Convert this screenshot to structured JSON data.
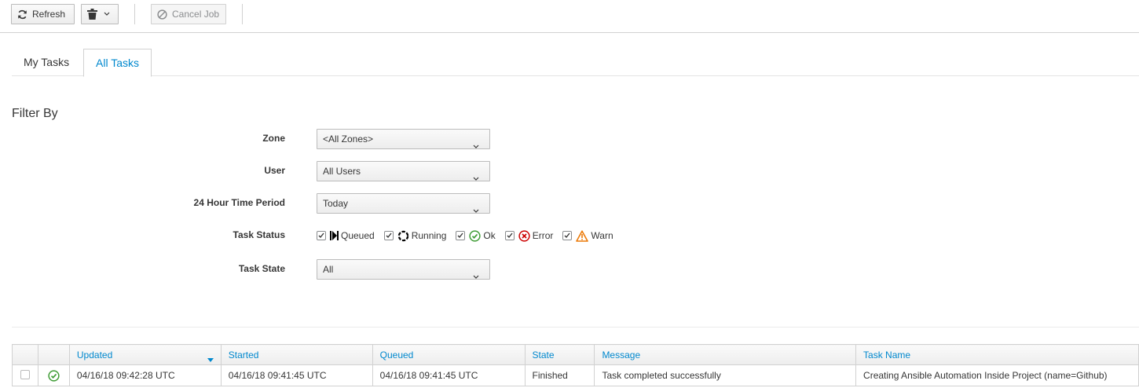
{
  "toolbar": {
    "refresh_label": "Refresh",
    "cancel_job_label": "Cancel Job"
  },
  "tabs": [
    {
      "label": "My Tasks",
      "active": false
    },
    {
      "label": "All Tasks",
      "active": true
    }
  ],
  "filter": {
    "title": "Filter By",
    "zone": {
      "label": "Zone",
      "value": "<All Zones>"
    },
    "user": {
      "label": "User",
      "value": "All Users"
    },
    "period": {
      "label": "24 Hour Time Period",
      "value": "Today"
    },
    "task_status": {
      "label": "Task Status",
      "options": [
        {
          "label": "Queued",
          "checked": true,
          "icon": "queued-icon"
        },
        {
          "label": "Running",
          "checked": true,
          "icon": "running-icon"
        },
        {
          "label": "Ok",
          "checked": true,
          "icon": "ok-icon",
          "color": "#3f9c35"
        },
        {
          "label": "Error",
          "checked": true,
          "icon": "error-icon",
          "color": "#cc0000"
        },
        {
          "label": "Warn",
          "checked": true,
          "icon": "warning-icon",
          "color": "#ec7a08"
        }
      ]
    },
    "task_state": {
      "label": "Task State",
      "value": "All"
    }
  },
  "table": {
    "columns": [
      "Updated",
      "Started",
      "Queued",
      "State",
      "Message",
      "Task Name"
    ],
    "sorted_column": "Updated",
    "rows": [
      {
        "checked": false,
        "status_icon": "ok-icon",
        "updated": "04/16/18 09:42:28 UTC",
        "started": "04/16/18 09:41:45 UTC",
        "queued": "04/16/18 09:41:45 UTC",
        "state": "Finished",
        "message": "Task completed successfully",
        "task_name": "Creating Ansible Automation Inside Project (name=Github)"
      }
    ]
  },
  "colors": {
    "accent": "#0088ce",
    "ok": "#3f9c35",
    "error": "#cc0000",
    "warn": "#ec7a08"
  }
}
